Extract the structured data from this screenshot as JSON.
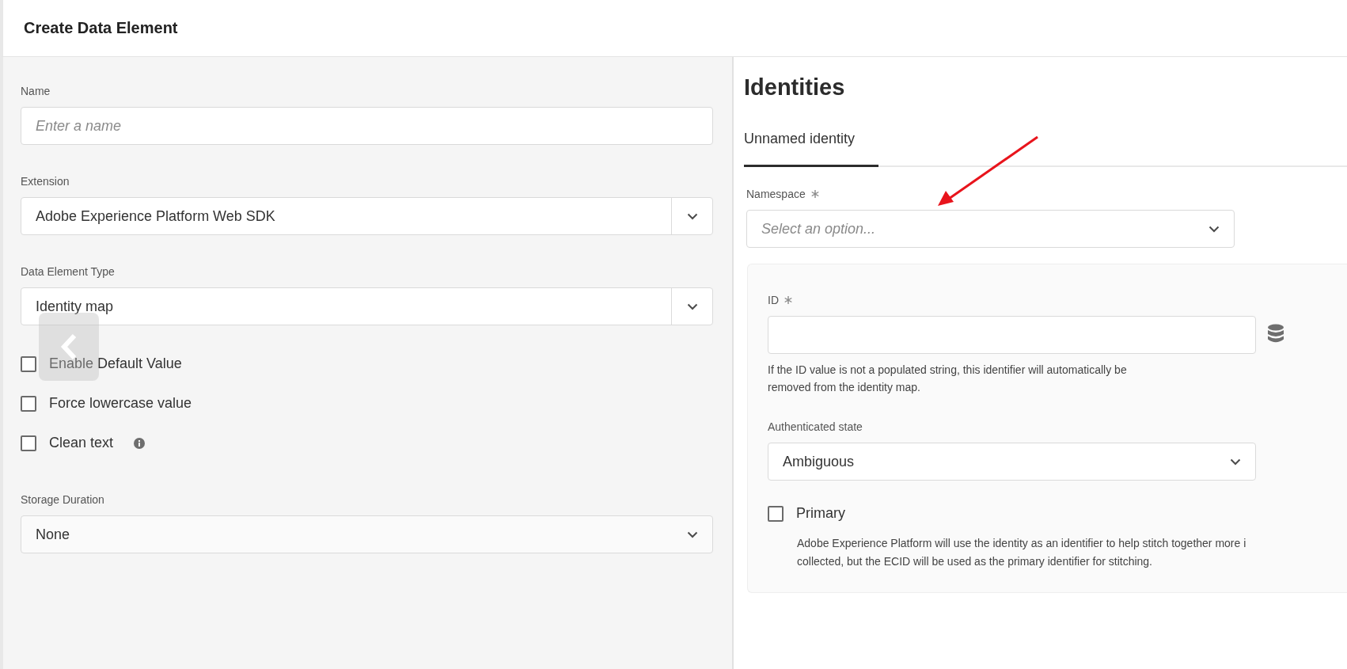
{
  "header": {
    "title": "Create Data Element"
  },
  "left_form": {
    "fields": [
      {
        "kind": "text",
        "label": "Name",
        "placeholder": "Enter a name"
      },
      {
        "kind": "split_select",
        "label": "Extension",
        "value": "Adobe Experience Platform Web SDK"
      },
      {
        "kind": "split_select",
        "label": "Data Element Type",
        "value": "Identity map"
      }
    ],
    "options": [
      {
        "label": "Enable Default Value",
        "checked": false,
        "info": false
      },
      {
        "label": "Force lowercase value",
        "checked": false,
        "info": false
      },
      {
        "label": "Clean text",
        "checked": false,
        "info": true
      }
    ],
    "storage": {
      "label": "Storage Duration",
      "value": "None"
    }
  },
  "right_panel": {
    "heading": "Identities",
    "tabs": [
      {
        "label": "Unnamed identity",
        "selected": true
      }
    ],
    "namespace": {
      "label": "Namespace",
      "required": true,
      "placeholder": "Select an option..."
    },
    "id_field": {
      "label": "ID",
      "required": true,
      "help_lines": [
        "If the ID value is not a populated string, this identifier will automatically be",
        "removed from the identity map."
      ]
    },
    "auth_state": {
      "label": "Authenticated state",
      "value": "Ambiguous"
    },
    "primary": {
      "label": "Primary",
      "checked": false,
      "description_lines": [
        "Adobe Experience Platform will use the identity as an identifier to help stitch together more i",
        "collected, but the ECID will be used as the primary identifier for stitching."
      ]
    }
  }
}
